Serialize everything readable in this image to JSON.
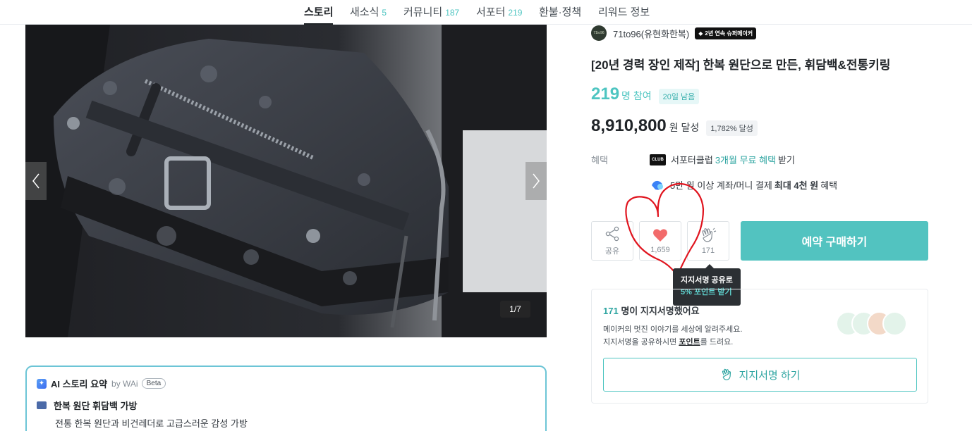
{
  "tabs": [
    {
      "label": "스토리",
      "count": "",
      "active": true
    },
    {
      "label": "새소식",
      "count": "5"
    },
    {
      "label": "커뮤니티",
      "count": "187"
    },
    {
      "label": "서포터",
      "count": "219"
    },
    {
      "label": "환불·정책",
      "count": ""
    },
    {
      "label": "리워드 정보",
      "count": ""
    }
  ],
  "gallery": {
    "counter": "1/7"
  },
  "maker": {
    "avatar_text": "71to96",
    "name": "71to96(유현화한복)",
    "badge": "2년 연속 슈퍼메이커"
  },
  "project": {
    "title": "[20년 경력 장인 제작] 한복 원단으로 만든, 휘담백&전통키링",
    "participants": "219",
    "participants_unit": "명 참여",
    "days_left": "20일 남음",
    "amount": "8,910,800",
    "amount_unit": "원 달성",
    "percent": "1,782% 달성"
  },
  "benefits": {
    "label": "혜택",
    "club_icon_text": "CLUB",
    "club": {
      "prefix": "서포터클럽",
      "highlight": "3개월 무료 혜택",
      "suffix": "받기"
    },
    "pay": {
      "prefix": "5만 원 이상 계좌/머니 결제",
      "highlight": "최대 4천 원",
      "suffix": "혜택"
    }
  },
  "actions": {
    "share_label": "공유",
    "like_count": "1,659",
    "cheer_count": "171",
    "buy_label": "예약 구매하기"
  },
  "tooltip": {
    "line1": "지지서명 공유로",
    "line2": "5% 포인트 받기"
  },
  "support": {
    "count": "171",
    "title_suffix": "명이 지지서명했어요",
    "desc_line1": "메이커의 멋진 이야기를 세상에 알려주세요.",
    "desc_line2_pre": "지지서명을 공유하시면",
    "desc_line2_link": "포인트",
    "desc_line2_post": "를 드려요.",
    "button_label": "지지서명 하기"
  },
  "ai_summary": {
    "title": "AI 스토리 요약",
    "by": "by WAi",
    "beta": "Beta",
    "item_title": "한복 원단 휘담백 가방",
    "item_desc": "전통 한복 원단과 비건레더로 고급스러운 감성 가방"
  },
  "colors": {
    "accent": "#52c3c0",
    "accent_text": "#2ea5a1",
    "annotation": "#e0141e"
  }
}
